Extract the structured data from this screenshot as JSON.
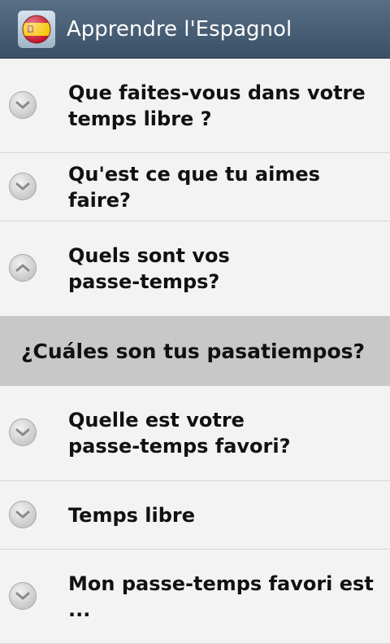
{
  "app_bar": {
    "title": "Apprendre l'Espagnol",
    "flag_icon": "spain-flag-icon"
  },
  "list": {
    "items": [
      {
        "label": "Que faites-vous dans votre temps libre ?",
        "icon": "chevron-down-icon",
        "expanded": false
      },
      {
        "label": "Qu'est ce que tu aimes faire?",
        "icon": "chevron-down-icon",
        "expanded": false
      },
      {
        "label": "Quels sont vos passe-temps?",
        "icon": "chevron-up-icon",
        "expanded": true,
        "answer": "¿Cuáles son tus pasatiempos?"
      },
      {
        "label": "Quelle est votre passe-temps favori?",
        "icon": "chevron-down-icon",
        "expanded": false
      },
      {
        "label": "Temps libre",
        "icon": "chevron-down-icon",
        "expanded": false
      },
      {
        "label": "Mon passe-temps favori est ...",
        "icon": "chevron-down-icon",
        "expanded": false
      }
    ]
  },
  "colors": {
    "app_bar_top": "#596f85",
    "app_bar_bottom": "#3a5066",
    "answer_background": "#c8c8c8",
    "list_background": "#f3f3f3"
  }
}
